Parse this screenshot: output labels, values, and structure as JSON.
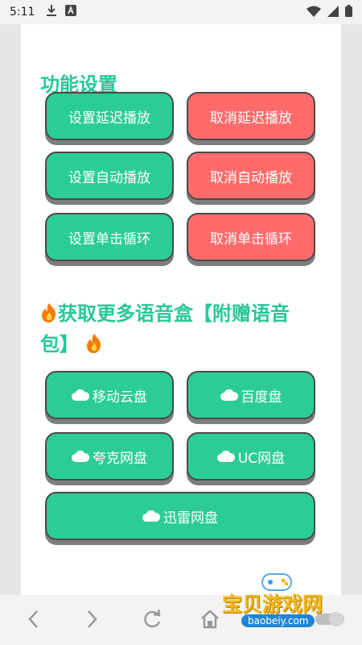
{
  "status": {
    "time": "5:11"
  },
  "sections": {
    "settings_title": "功能设置",
    "more_title_part1": "获取更多语音盒【附赠语音",
    "more_title_part2": "包】"
  },
  "buttons": {
    "set_delay": "设置延迟播放",
    "cancel_delay": "取消延迟播放",
    "set_auto": "设置自动播放",
    "cancel_auto": "取消自动播放",
    "set_loop": "设置单击循环",
    "cancel_loop": "取消单击循环",
    "mobile_cloud": "移动云盘",
    "baidu": "百度盘",
    "quark": "夸克网盘",
    "uc": "UC网盘",
    "xunlei": "迅雷网盘"
  },
  "watermark": {
    "name": "宝贝游戏网",
    "domain": "baobeiy.com"
  },
  "colors": {
    "accent_green": "#2ccd95",
    "title_green": "#29c79a",
    "cancel_red": "#ff6b6b"
  },
  "icons": [
    "download-icon",
    "a-icon",
    "wifi-icon",
    "signal-icon",
    "battery-icon",
    "fire-icon",
    "cloud-icon",
    "back-icon",
    "forward-icon",
    "refresh-icon",
    "home-icon"
  ]
}
